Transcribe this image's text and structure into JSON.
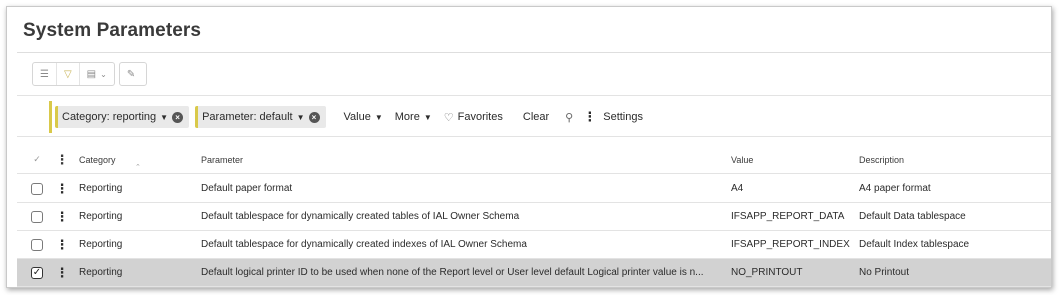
{
  "page": {
    "title": "System Parameters"
  },
  "toolbar": {
    "list_icon": "list-icon",
    "filter_icon": "filter-icon",
    "export_icon": "export-icon",
    "edit_icon": "edit-icon"
  },
  "filters": {
    "chips": [
      {
        "label": "Category: reporting"
      },
      {
        "label": "Parameter: default"
      }
    ],
    "value_label": "Value",
    "more_label": "More",
    "favorites_label": "Favorites",
    "clear_label": "Clear",
    "settings_label": "Settings"
  },
  "table": {
    "columns": [
      "Category",
      "Parameter",
      "Value",
      "Description"
    ],
    "rows": [
      {
        "category": "Reporting",
        "parameter": "Default paper format",
        "value": "A4",
        "description": "A4 paper format",
        "selected": false
      },
      {
        "category": "Reporting",
        "parameter": "Default tablespace for dynamically created tables of IAL Owner Schema",
        "value": "IFSAPP_REPORT_DATA",
        "description": "Default Data tablespace",
        "selected": false
      },
      {
        "category": "Reporting",
        "parameter": "Default tablespace for dynamically created indexes of IAL Owner Schema",
        "value": "IFSAPP_REPORT_INDEX",
        "description": "Default Index tablespace",
        "selected": false
      },
      {
        "category": "Reporting",
        "parameter": "Default logical printer ID to be used when none of the Report level or User level default Logical printer value is n...",
        "value": "NO_PRINTOUT",
        "description": "No Printout",
        "selected": true
      }
    ]
  },
  "colors": {
    "accent": "#d9c94a",
    "selected_row": "#d2d2d2"
  }
}
